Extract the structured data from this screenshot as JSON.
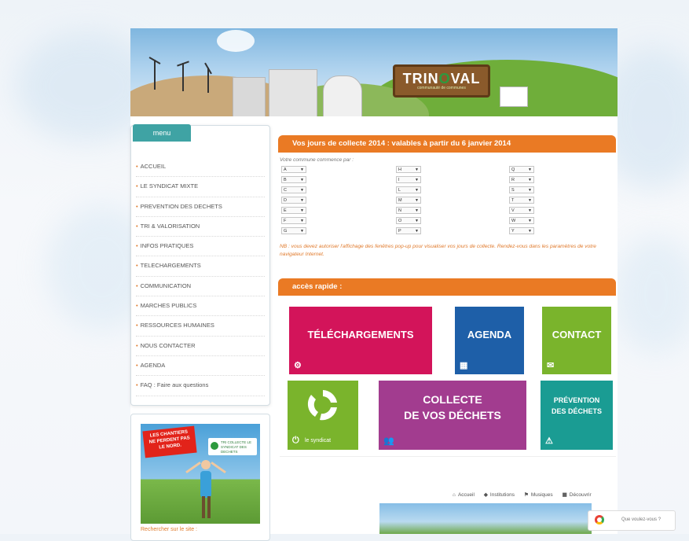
{
  "logo": {
    "word_prefix": "TRIN",
    "word_accent": "O",
    "word_suffix": "VAL",
    "tagline": "communauté de communes"
  },
  "menu": {
    "tab_label": "menu",
    "items": [
      {
        "label": "ACCUEIL"
      },
      {
        "label": "LE SYNDICAT MIXTE"
      },
      {
        "label": "PREVENTION DES DECHETS"
      },
      {
        "label": "TRI & VALORISATION"
      },
      {
        "label": "INFOS PRATIQUES"
      },
      {
        "label": "TELECHARGEMENTS"
      },
      {
        "label": "COMMUNICATION"
      },
      {
        "label": "MARCHES PUBLICS"
      },
      {
        "label": "RESSOURCES HUMAINES"
      },
      {
        "label": "NOUS CONTACTER"
      },
      {
        "label": "AGENDA"
      },
      {
        "label": "FAQ : Faire aux questions"
      }
    ]
  },
  "promo": {
    "flag_text": "LES CHANTIERS NE PERDENT PAS LE NORD.",
    "badge_text": "TRI COLLECTE LE SYNDICAT DES DECHETS",
    "search_label": "Rechercher sur le site :"
  },
  "collecte": {
    "title": "Vos jours de collecte 2014 : valables à partir du 6 janvier 2014",
    "intro": "Votre commune commence par :",
    "col1": [
      "A",
      "B",
      "C",
      "D",
      "E",
      "F",
      "G"
    ],
    "col2": [
      "H",
      "I",
      "L",
      "M",
      "N",
      "O",
      "P"
    ],
    "col3": [
      "Q",
      "R",
      "S",
      "T",
      "V",
      "W",
      "Y"
    ],
    "notice": "NB : vous devez autoriser l'affichage des fenêtres pop-up pour visualiser vos jours de collecte. Rendez-vous dans les paramètres de votre navigateur Internet."
  },
  "acces": {
    "title": "accès rapide :",
    "tiles": {
      "telechargements": "TÉLÉCHARGEMENTS",
      "agenda": "AGENDA",
      "contact": "CONTACT",
      "syndicat": "le syndicat",
      "collecte_line1": "COLLECTE",
      "collecte_line2": "DE VOS DÉCHETS",
      "prevention_line1": "PRÉVENTION",
      "prevention_line2": "DES DÉCHETS"
    },
    "colors": {
      "telechargements": "#d3145a",
      "agenda": "#1e5fa8",
      "contact": "#7ab42c",
      "syndicat": "#7ab42c",
      "collecte": "#a23c8f",
      "prevention": "#1a9c93"
    }
  },
  "browser_nav": {
    "items": [
      "Accueil",
      "Institutions",
      "Musiques",
      "Découvrir"
    ],
    "search_placeholder": "Que voulez-vous ?"
  }
}
